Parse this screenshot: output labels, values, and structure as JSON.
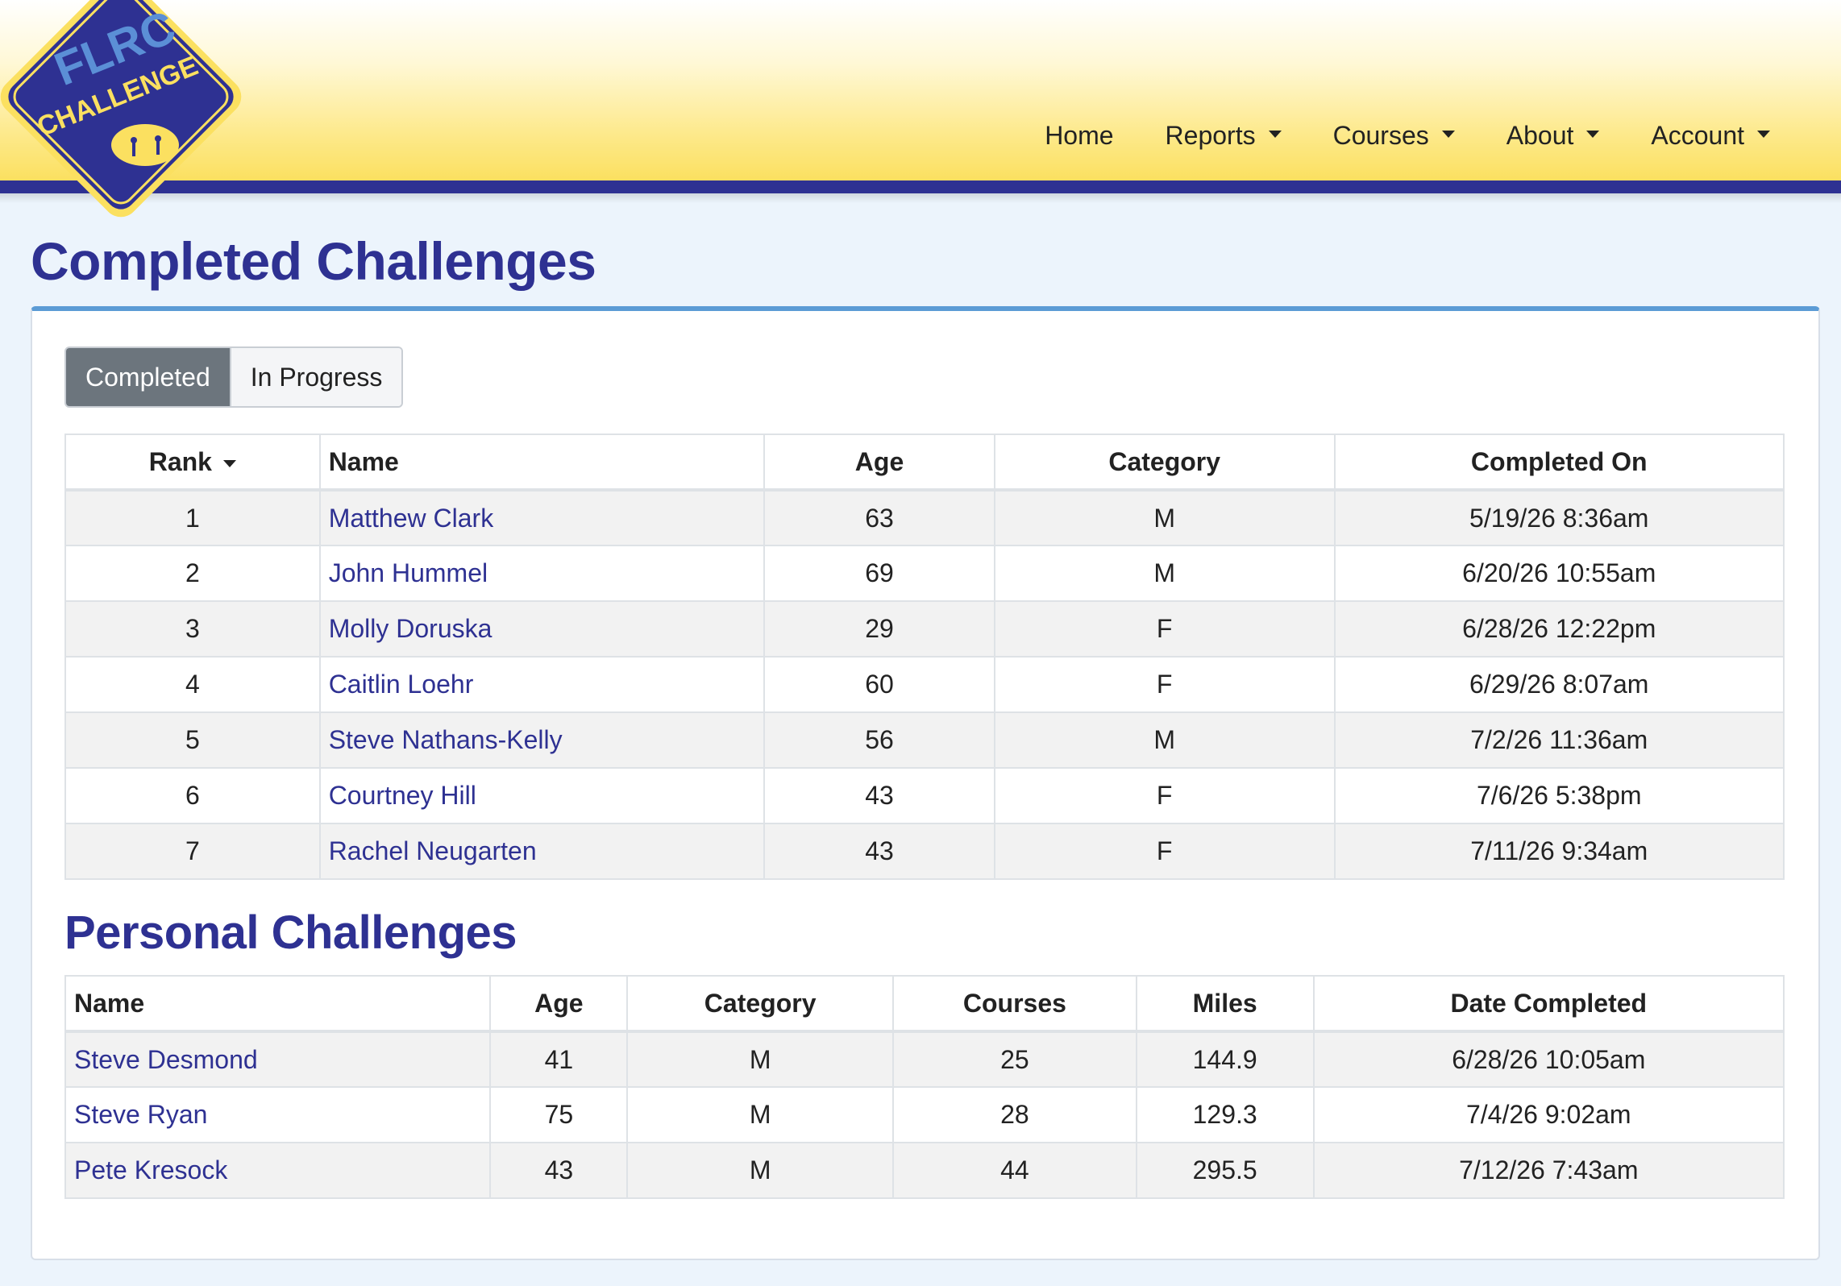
{
  "logo": {
    "line1": "FLRC",
    "line2": "CHALLENGE"
  },
  "nav": {
    "items": [
      {
        "label": "Home",
        "dropdown": false
      },
      {
        "label": "Reports",
        "dropdown": true
      },
      {
        "label": "Courses",
        "dropdown": true
      },
      {
        "label": "About",
        "dropdown": true
      },
      {
        "label": "Account",
        "dropdown": true
      }
    ]
  },
  "page_title": "Completed Challenges",
  "toggle": {
    "completed": "Completed",
    "in_progress": "In Progress",
    "selected": "Completed"
  },
  "completed_table": {
    "headers": {
      "rank": "Rank",
      "name": "Name",
      "age": "Age",
      "category": "Category",
      "completed_on": "Completed On"
    },
    "rows": [
      {
        "rank": "1",
        "name": "Matthew Clark",
        "age": "63",
        "category": "M",
        "completed_on": "5/19/26 8:36am"
      },
      {
        "rank": "2",
        "name": "John Hummel",
        "age": "69",
        "category": "M",
        "completed_on": "6/20/26 10:55am"
      },
      {
        "rank": "3",
        "name": "Molly Doruska",
        "age": "29",
        "category": "F",
        "completed_on": "6/28/26 12:22pm"
      },
      {
        "rank": "4",
        "name": "Caitlin Loehr",
        "age": "60",
        "category": "F",
        "completed_on": "6/29/26 8:07am"
      },
      {
        "rank": "5",
        "name": "Steve Nathans-Kelly",
        "age": "56",
        "category": "M",
        "completed_on": "7/2/26 11:36am"
      },
      {
        "rank": "6",
        "name": "Courtney Hill",
        "age": "43",
        "category": "F",
        "completed_on": "7/6/26 5:38pm"
      },
      {
        "rank": "7",
        "name": "Rachel Neugarten",
        "age": "43",
        "category": "F",
        "completed_on": "7/11/26 9:34am"
      }
    ]
  },
  "personal_section": {
    "title": "Personal Challenges",
    "headers": {
      "name": "Name",
      "age": "Age",
      "category": "Category",
      "courses": "Courses",
      "miles": "Miles",
      "date_completed": "Date Completed"
    },
    "rows": [
      {
        "name": "Steve Desmond",
        "age": "41",
        "category": "M",
        "courses": "25",
        "miles": "144.9",
        "date_completed": "6/28/26 10:05am"
      },
      {
        "name": "Steve Ryan",
        "age": "75",
        "category": "M",
        "courses": "28",
        "miles": "129.3",
        "date_completed": "7/4/26 9:02am"
      },
      {
        "name": "Pete Kresock",
        "age": "43",
        "category": "M",
        "courses": "44",
        "miles": "295.5",
        "date_completed": "7/12/26 7:43am"
      }
    ]
  },
  "colors": {
    "brand_navy": "#2e3192",
    "brand_yellow": "#fbe060",
    "card_accent": "#5b9bd5",
    "toggle_active": "#6c757d"
  }
}
